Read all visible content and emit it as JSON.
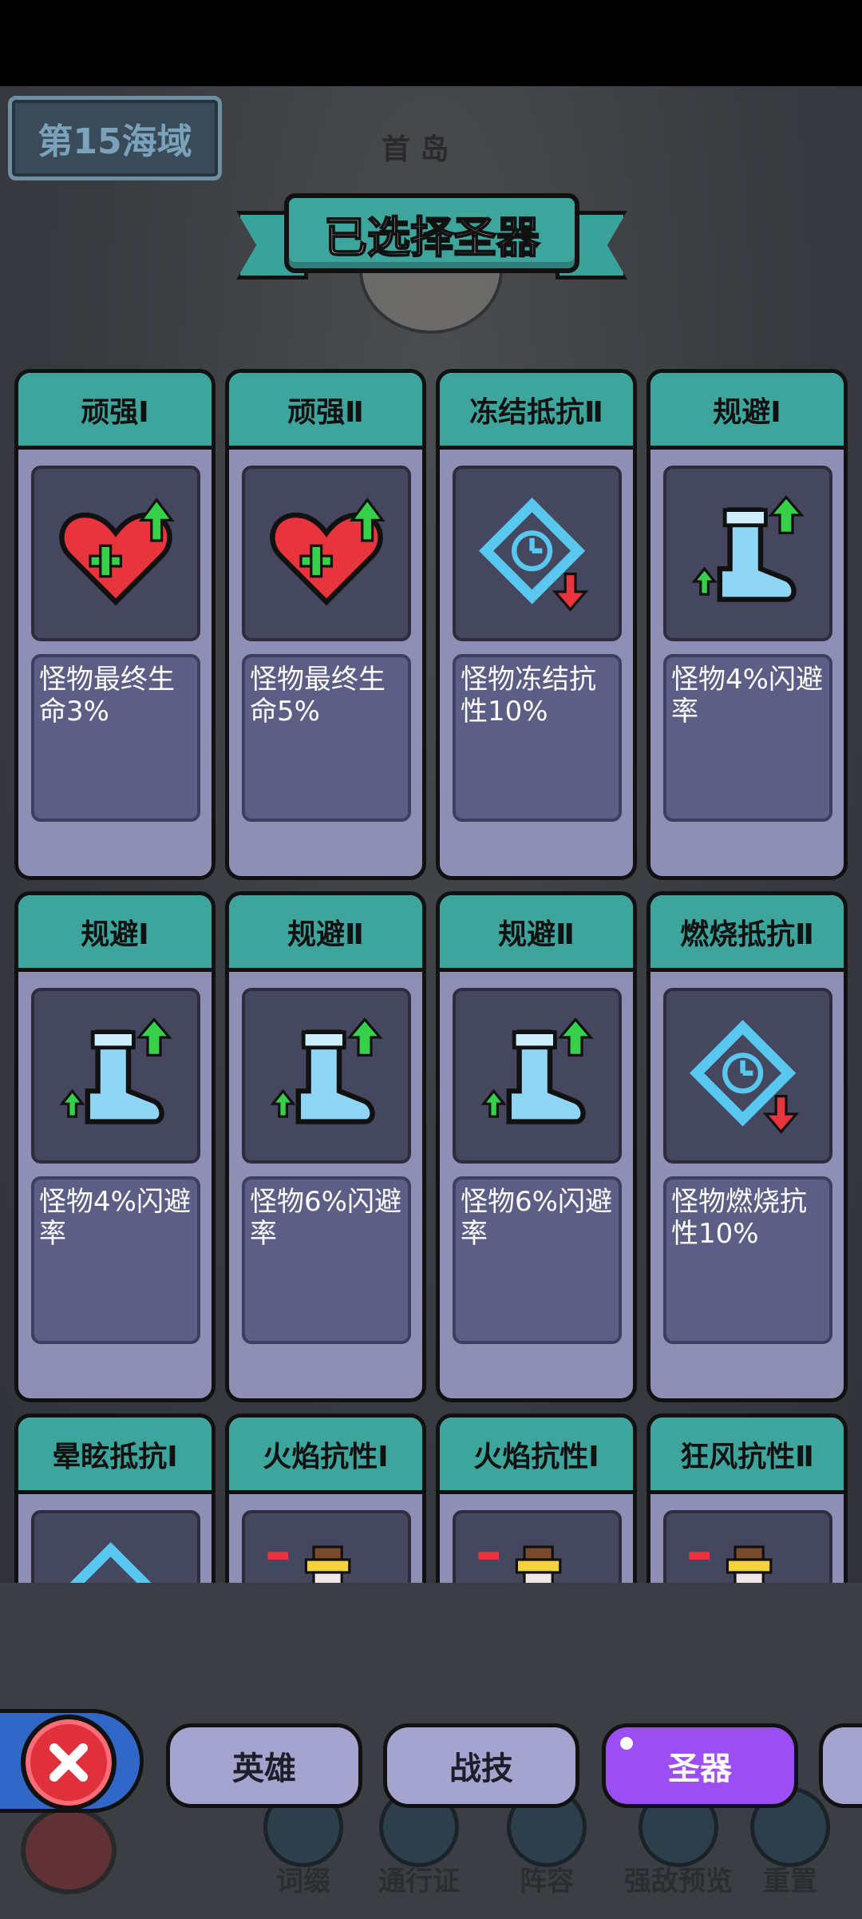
{
  "sea_zone": {
    "label": "第15海域"
  },
  "map": {
    "island_label": "首 岛"
  },
  "header": {
    "title": "已选择圣器"
  },
  "cards": [
    {
      "title": "顽强Ⅰ",
      "icon": "heart-plus-icon",
      "description": "怪物最终生命3%"
    },
    {
      "title": "顽强Ⅱ",
      "icon": "heart-plus-icon",
      "description": "怪物最终生命5%"
    },
    {
      "title": "冻结抵抗Ⅱ",
      "icon": "clock-diamond-icon",
      "description": "怪物冻结抗性10%"
    },
    {
      "title": "规避Ⅰ",
      "icon": "boot-icon",
      "description": "怪物4%闪避率"
    },
    {
      "title": "规避Ⅰ",
      "icon": "boot-icon",
      "description": "怪物4%闪避率"
    },
    {
      "title": "规避Ⅱ",
      "icon": "boot-icon",
      "description": "怪物6%闪避率"
    },
    {
      "title": "规避Ⅱ",
      "icon": "boot-icon",
      "description": "怪物6%闪避率"
    },
    {
      "title": "燃烧抵抗Ⅱ",
      "icon": "clock-diamond-icon",
      "description": "怪物燃烧抗性10%"
    },
    {
      "title": "晕眩抵抗Ⅰ",
      "icon": "clock-diamond-icon",
      "description": ""
    },
    {
      "title": "火焰抗性Ⅰ",
      "icon": "potion-icon",
      "description": ""
    },
    {
      "title": "火焰抗性Ⅰ",
      "icon": "potion-icon",
      "description": ""
    },
    {
      "title": "狂风抗性Ⅱ",
      "icon": "potion-icon",
      "description": ""
    }
  ],
  "tabs": [
    {
      "label": "英雄"
    },
    {
      "label": "战技"
    },
    {
      "label": "圣器",
      "active": true
    }
  ],
  "bottom_nav": [
    {
      "label": "词缀"
    },
    {
      "label": "通行证"
    },
    {
      "label": "阵容"
    },
    {
      "label": "强敌预览"
    },
    {
      "label": "重置"
    }
  ],
  "colors": {
    "card_header": "#3ea59d",
    "active_tab": "#9b4ef2",
    "close_button": "#e0303c",
    "arrow_up": "#37d04a",
    "arrow_down": "#e8343c"
  }
}
